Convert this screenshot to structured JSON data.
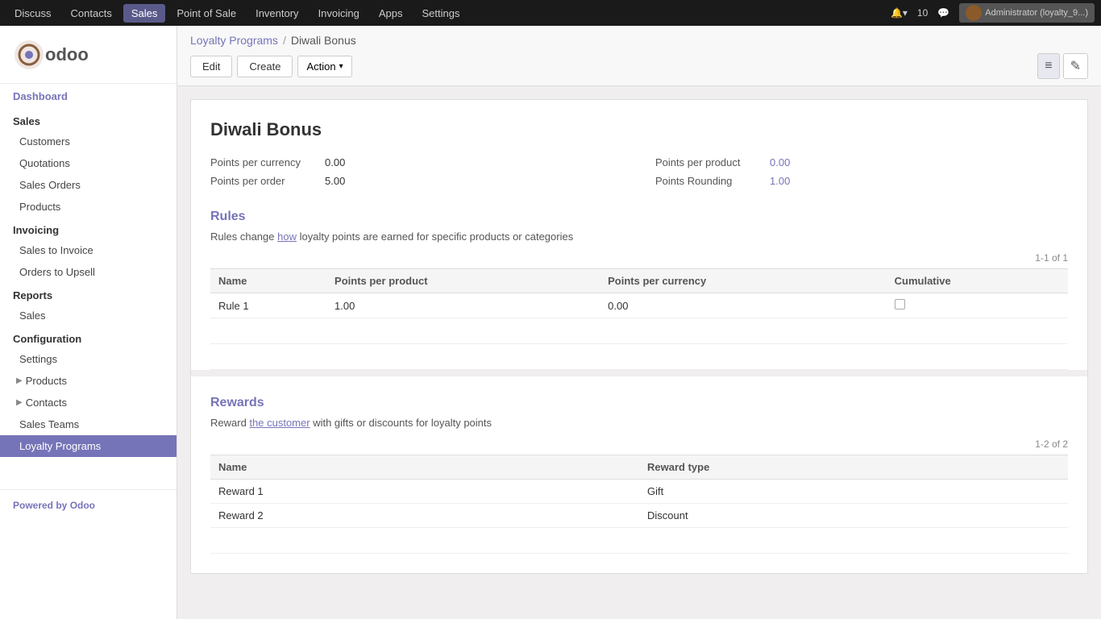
{
  "topnav": {
    "items": [
      "Discuss",
      "Contacts",
      "Sales",
      "Point of Sale",
      "Inventory",
      "Invoicing",
      "Apps",
      "Settings"
    ],
    "active_item": "Sales",
    "notifications_count": "10",
    "admin_label": "Administrator (loyalty_9...)"
  },
  "sidebar": {
    "logo_text": "odoo",
    "dashboard_label": "Dashboard",
    "sales_section": "Sales",
    "sales_items": [
      "Customers",
      "Quotations",
      "Sales Orders",
      "Products"
    ],
    "invoicing_section": "Invoicing",
    "invoicing_items": [
      "Sales to Invoice",
      "Orders to Upsell"
    ],
    "reports_section": "Reports",
    "reports_items": [
      "Sales"
    ],
    "configuration_section": "Configuration",
    "configuration_items": [
      "Settings"
    ],
    "configuration_expandable": [
      "Products",
      "Contacts"
    ],
    "sales_teams_item": "Sales Teams",
    "loyalty_programs_item": "Loyalty Programs",
    "footer_text": "Powered by ",
    "footer_brand": "Odoo"
  },
  "breadcrumb": {
    "parent_label": "Loyalty Programs",
    "separator": "/",
    "current_label": "Diwali Bonus"
  },
  "toolbar": {
    "edit_label": "Edit",
    "create_label": "Create",
    "action_label": "Action",
    "view_list_icon": "≡",
    "view_edit_icon": "✎"
  },
  "form": {
    "title": "Diwali Bonus",
    "fields": {
      "points_per_currency_label": "Points per currency",
      "points_per_currency_value": "0.00",
      "points_per_product_label": "Points per product",
      "points_per_product_value": "0.00",
      "points_per_order_label": "Points per order",
      "points_per_order_value": "5.00",
      "points_rounding_label": "Points Rounding",
      "points_rounding_value": "1.00"
    },
    "rules_section": {
      "title": "Rules",
      "description": "Rules change how loyalty points are earned for specific products or categories",
      "description_link_word": "how",
      "count_label": "1-1 of 1",
      "table_headers": [
        "Name",
        "Points per product",
        "Points per currency",
        "Cumulative"
      ],
      "rows": [
        {
          "name": "Rule 1",
          "points_per_product": "1.00",
          "points_per_currency": "0.00",
          "cumulative": false
        }
      ]
    },
    "rewards_section": {
      "title": "Rewards",
      "description": "Reward the customer with gifts or discounts for loyalty points",
      "description_link_word": "the customer",
      "count_label": "1-2 of 2",
      "table_headers": [
        "Name",
        "Reward type"
      ],
      "rows": [
        {
          "name": "Reward 1",
          "reward_type": "Gift"
        },
        {
          "name": "Reward 2",
          "reward_type": "Discount"
        }
      ]
    }
  },
  "colors": {
    "accent": "#7674b8",
    "active_nav": "#7674b8",
    "link": "#7674b8"
  }
}
